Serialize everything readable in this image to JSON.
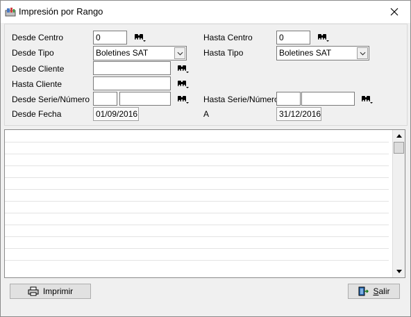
{
  "window": {
    "title": "Impresión por Rango"
  },
  "form": {
    "desde_centro_label": "Desde Centro",
    "desde_centro_value": "0",
    "hasta_centro_label": "Hasta Centro",
    "hasta_centro_value": "0",
    "desde_tipo_label": "Desde Tipo",
    "desde_tipo_value": "Boletines SAT",
    "hasta_tipo_label": "Hasta Tipo",
    "hasta_tipo_value": "Boletines SAT",
    "desde_cliente_label": "Desde Cliente",
    "desde_cliente_value": "",
    "hasta_cliente_label": "Hasta Cliente",
    "hasta_cliente_value": "",
    "desde_serie_label": "Desde Serie/Número",
    "desde_serie_value": "",
    "desde_numero_value": "",
    "hasta_serie_label": "Hasta Serie/Número",
    "hasta_serie_value": "",
    "hasta_numero_value": "",
    "desde_fecha_label": "Desde Fecha",
    "desde_fecha_value": "01/09/2016",
    "hasta_fecha_label": "A",
    "hasta_fecha_value": "31/12/2016"
  },
  "buttons": {
    "print_label": "Imprimir",
    "exit_label_underlined": "S",
    "exit_label_rest": "alir"
  },
  "icons": {
    "app": "report-app-icon",
    "find": "binoculars-icon",
    "print": "printer-icon",
    "exit": "exit-door-icon",
    "close": "close-icon"
  }
}
